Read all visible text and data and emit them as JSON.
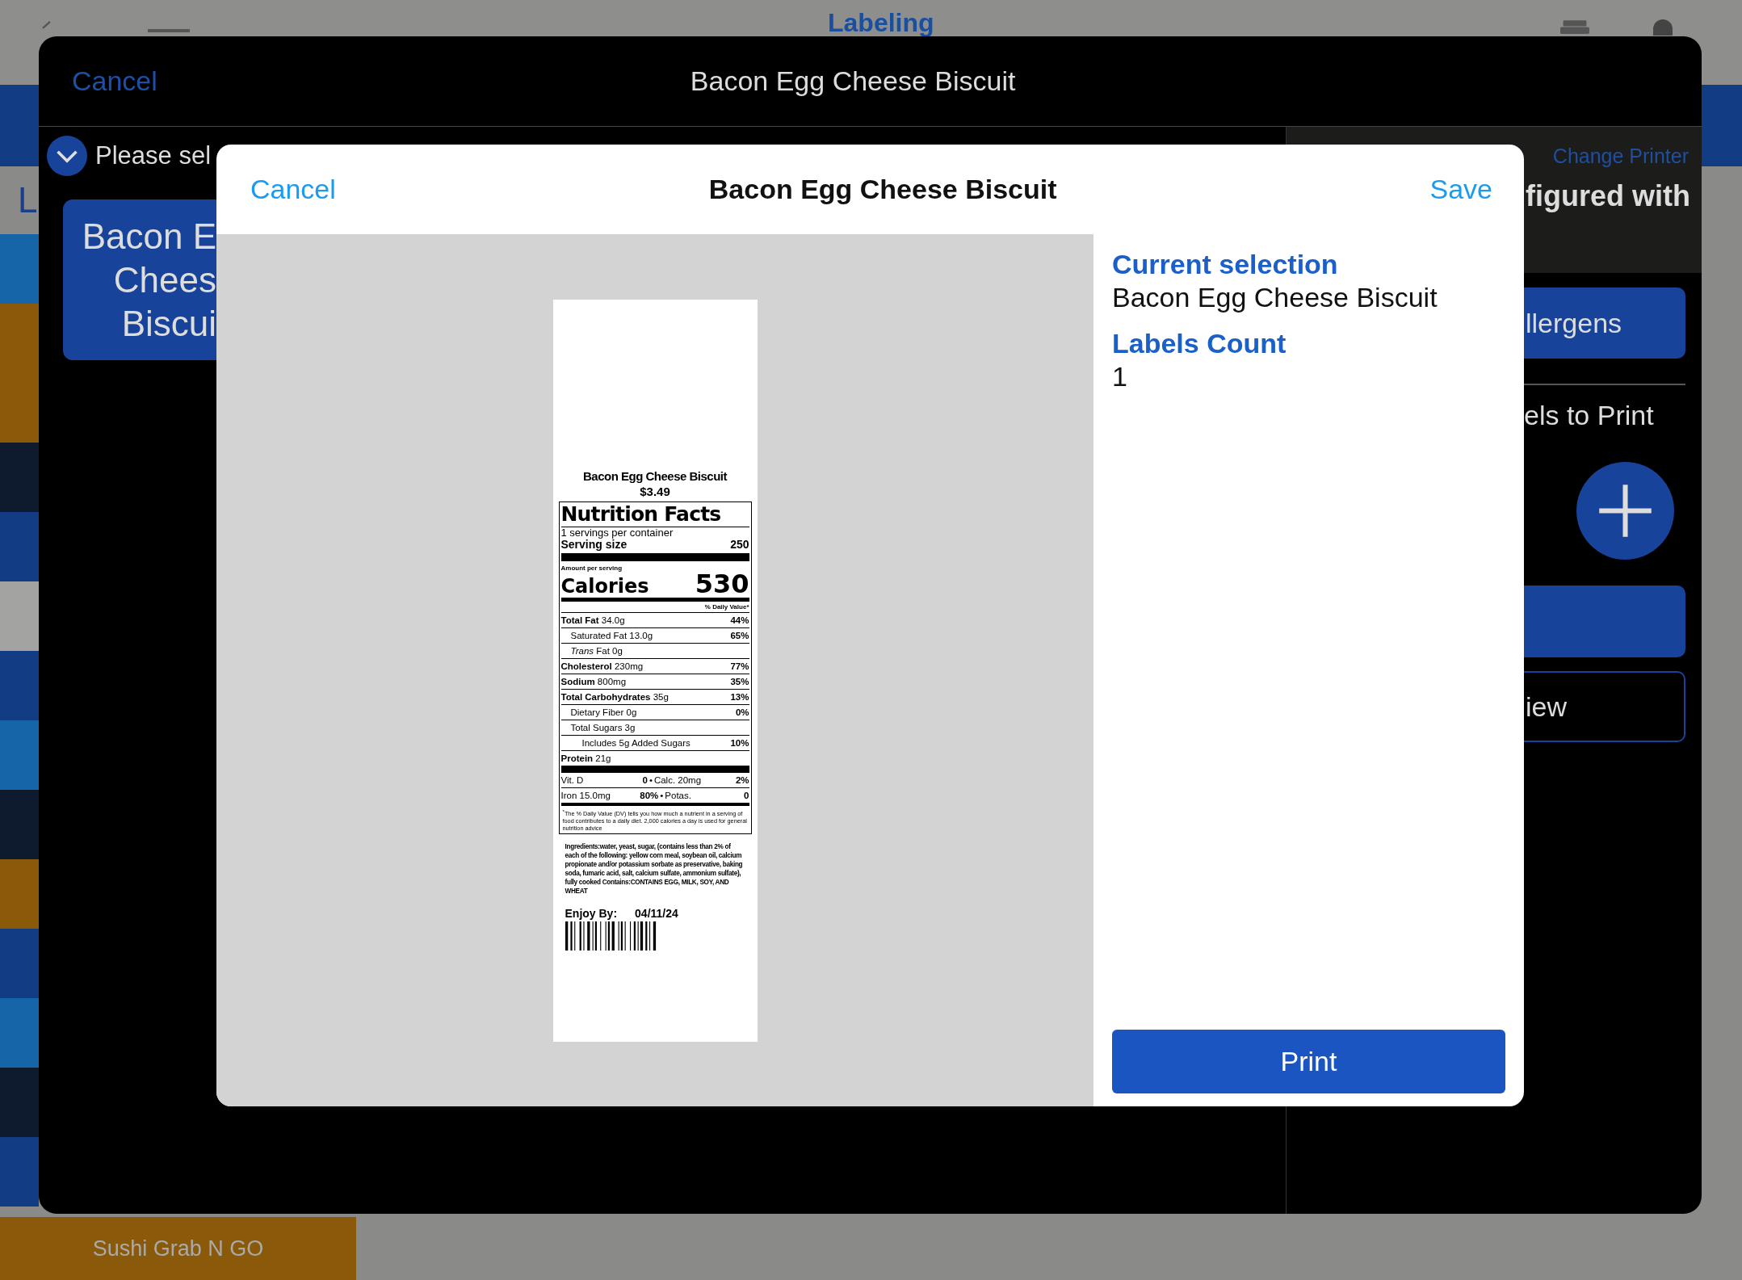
{
  "background_app": {
    "title": "Labeling",
    "section_letter": "L",
    "bottom_tile": "Sushi Grab N GO",
    "side_tiles": [
      {
        "color": "#1565a8"
      },
      {
        "color": "#8a5a0a"
      },
      {
        "color": "#8a5a0a"
      },
      {
        "color": "#0e1a2e"
      },
      {
        "color": "#123d85"
      },
      {
        "color": "#a3a3a1"
      },
      {
        "color": "#123d85"
      },
      {
        "color": "#1565a8"
      },
      {
        "color": "#0e1a2e"
      },
      {
        "color": "#8a5a0a"
      },
      {
        "color": "#123d85"
      },
      {
        "color": "#1565a8"
      },
      {
        "color": "#0e1a2e"
      },
      {
        "color": "#123d85"
      }
    ]
  },
  "sheet": {
    "cancel": "Cancel",
    "title": "Bacon Egg Cheese Biscuit",
    "prompt": "Please sel",
    "item_card_lines": [
      "Bacon E",
      "Chees",
      "Biscui"
    ],
    "change_printer": "Change Printer",
    "printer_note": "figured with",
    "allergens_button": "llergens",
    "labels_to_print": "els to Print",
    "view_button": "iew"
  },
  "dialog": {
    "cancel": "Cancel",
    "title": "Bacon Egg Cheese Biscuit",
    "save": "Save",
    "label": {
      "name": "Bacon Egg Cheese Biscuit",
      "price": "$3.49",
      "heading": "Nutrition Facts",
      "servings": "1 servings per container",
      "serving_size_label": "Serving size",
      "serving_size": "250",
      "amount_per_serving": "Amount per serving",
      "calories_label": "Calories",
      "calories": "530",
      "daily_value_heading": "% Daily Value*",
      "nutrients": [
        {
          "kind": "main",
          "name": "Total Fat",
          "amount": "34.0g",
          "dv": "44%"
        },
        {
          "kind": "sub",
          "name": "Saturated Fat 13.0g",
          "dv": "65%"
        },
        {
          "kind": "sub",
          "name": "*Trans* Fat 0g"
        },
        {
          "kind": "main",
          "name": "Cholesterol",
          "amount": "230mg",
          "dv": "77%"
        },
        {
          "kind": "main",
          "name": "Sodium",
          "amount": "800mg",
          "dv": "35%"
        },
        {
          "kind": "main",
          "name": "Total Carbohydrates",
          "amount": "35g",
          "dv": "13%"
        },
        {
          "kind": "sub",
          "name": "Dietary Fiber 0g",
          "dv": "0%"
        },
        {
          "kind": "sub",
          "name": "Total Sugars 3g"
        },
        {
          "kind": "subsub",
          "name": "Includes 5g Added Sugars",
          "dv": "10%"
        },
        {
          "kind": "main",
          "name": "Protein",
          "amount": "21g"
        }
      ],
      "minerals": [
        {
          "left": "Vit. D",
          "left_dv": "0",
          "separator": "•",
          "right": "Calc. 20mg",
          "right_dv": "2%"
        },
        {
          "left": "Iron 15.0mg",
          "left_dv": "80%",
          "separator": "•",
          "right": "Potas.",
          "right_dv": "0"
        }
      ],
      "footnote": "$^{*}$The % Daily Value (DV) tells you how much a nutrient in a serving of food contributes to a daily diet. 2,000 calories a day is used for general nutrition advice",
      "ingredients": "Ingredients:water, yeast, sugar, (contains less than 2% of each of the following: yellow corn meal, soybean oil, calcium propionate and/or potassium sorbate as preservative, baking soda, fumaric acid, salt, calcium sulfate, ammonium sulfate), fully cooked Contains:CONTAINS EGG, MILK, SOY, AND WHEAT",
      "enjoy_by_label": "Enjoy By:",
      "enjoy_by": "04/11/24"
    },
    "current_selection_heading": "Current selection",
    "current_selection": "Bacon Egg Cheese Biscuit",
    "labels_count_heading": "Labels Count",
    "labels_count": "1",
    "print_button": "Print"
  }
}
